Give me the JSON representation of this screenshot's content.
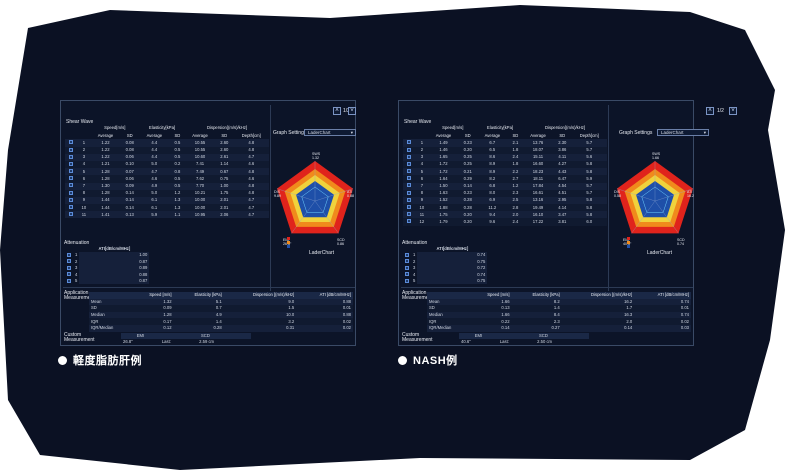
{
  "colors": {
    "background_shape": "#0b1123",
    "panel_bg": "#0c1428",
    "radar_red": "#e0231c",
    "radar_orange": "#f08a1c",
    "radar_yellow": "#f0d23c",
    "radar_blue": "#1e4fa8"
  },
  "left": {
    "caption": "軽度脂肪肝例",
    "shear_wave_title": "Shear Wave",
    "group_headers": [
      "Speed[m/s]",
      "Elasticity[kPa]",
      "Dispersion[(m/s)/kHz]"
    ],
    "sub_headers": [
      "Average",
      "SD",
      "Average",
      "SD",
      "Average",
      "SD",
      "Depth[cm]"
    ],
    "rows": [
      [
        "1",
        "1.22",
        "0.08",
        "4.4",
        "0.5",
        "10.55",
        "2.60",
        "4.8"
      ],
      [
        "2",
        "1.22",
        "0.08",
        "4.4",
        "0.5",
        "10.55",
        "2.60",
        "4.8"
      ],
      [
        "3",
        "1.22",
        "0.06",
        "4.4",
        "0.5",
        "10.60",
        "2.61",
        "4.7"
      ],
      [
        "4",
        "1.21",
        "0.10",
        "5.0",
        "0.2",
        "7.41",
        "1.14",
        "4.6"
      ],
      [
        "5",
        "1.28",
        "0.07",
        "4.7",
        "0.8",
        "7.49",
        "0.67",
        "4.8"
      ],
      [
        "6",
        "1.28",
        "0.06",
        "4.6",
        "0.5",
        "7.62",
        "0.75",
        "4.6"
      ],
      [
        "7",
        "1.30",
        "0.09",
        "4.9",
        "0.5",
        "7.70",
        "1.00",
        "4.8"
      ],
      [
        "8",
        "1.28",
        "0.14",
        "5.0",
        "1.2",
        "10.21",
        "1.75",
        "4.8"
      ],
      [
        "9",
        "1.44",
        "0.14",
        "6.1",
        "1.3",
        "10.00",
        "2.01",
        "4.7"
      ],
      [
        "10",
        "1.44",
        "0.14",
        "6.1",
        "1.3",
        "10.00",
        "2.01",
        "4.7"
      ],
      [
        "11",
        "1.41",
        "0.13",
        "5.9",
        "1.1",
        "10.95",
        "2.06",
        "4.7"
      ]
    ],
    "attenuation_title": "Attenuation",
    "att_header": "ATI[dB/cm/MHz]",
    "att_rows": [
      [
        "1",
        "1.00"
      ],
      [
        "2",
        "0.87"
      ],
      [
        "3",
        "0.89"
      ],
      [
        "4",
        "0.88"
      ],
      [
        "5",
        "0.87"
      ]
    ],
    "app_title": "Application Measurement",
    "meas_headers": [
      "Speed [m/s]",
      "Elasticity [kPa]",
      "Dispersion [(m/s)/kHz]",
      "ATI [dB/cm/MHz]"
    ],
    "meas_rows": [
      [
        "Mean",
        "1.32",
        "5.1",
        "9.0",
        "0.88"
      ],
      [
        "SD",
        "0.09",
        "0.7",
        "1.5",
        "0.01"
      ],
      [
        "Median",
        "1.28",
        "4.9",
        "10.0",
        "0.88"
      ],
      [
        "IQR",
        "0.17",
        "1.4",
        "3.2",
        "0.02"
      ],
      [
        "IQR/Median",
        "0.12",
        "0.28",
        "0.31",
        "0.02"
      ]
    ],
    "custom_title": "Custom Measurement",
    "custom_headers": [
      "EMI",
      "SCD"
    ],
    "custom_values": [
      "26.8\"",
      "Last:",
      "2.59 cm"
    ],
    "graph_settings_label": "Graph Settings",
    "graph_select": "LaderChart",
    "pager": "1/2",
    "radar_labels": {
      "top": "SWS",
      "top_val": "1.32",
      "left": "DIS",
      "left_val": "9.89",
      "right": "ATI",
      "right_val": "0.88",
      "bl": "EMI",
      "bl_val": "26.8\"",
      "br": "SCD",
      "br_val": "0.86"
    },
    "chart_title": "LaderChart"
  },
  "right": {
    "caption": "NASH例",
    "shear_wave_title": "Shear Wave",
    "group_headers": [
      "Speed[m/s]",
      "Elasticity[kPa]",
      "Dispersion[(m/s)/kHz]"
    ],
    "sub_headers": [
      "Average",
      "SD",
      "Average",
      "SD",
      "Average",
      "SD",
      "Depth[cm]"
    ],
    "rows": [
      [
        "1",
        "1.49",
        "0.23",
        "6.7",
        "2.1",
        "13.76",
        "2.30",
        "5.7"
      ],
      [
        "2",
        "1.46",
        "0.20",
        "6.5",
        "1.8",
        "18.07",
        "3.86",
        "5.7"
      ],
      [
        "3",
        "1.65",
        "0.25",
        "8.6",
        "2.4",
        "15.11",
        "4.11",
        "5.6"
      ],
      [
        "4",
        "1.72",
        "0.25",
        "8.9",
        "1.8",
        "16.60",
        "4.27",
        "5.8"
      ],
      [
        "5",
        "1.72",
        "0.21",
        "8.9",
        "2.2",
        "18.23",
        "4.43",
        "5.8"
      ],
      [
        "6",
        "1.64",
        "0.29",
        "8.2",
        "2.7",
        "18.11",
        "6.47",
        "5.9"
      ],
      [
        "7",
        "1.50",
        "0.14",
        "6.8",
        "1.2",
        "17.84",
        "4.54",
        "5.7"
      ],
      [
        "8",
        "1.63",
        "0.23",
        "8.0",
        "2.3",
        "16.61",
        "4.51",
        "5.7"
      ],
      [
        "9",
        "1.52",
        "0.28",
        "6.9",
        "2.5",
        "13.16",
        "2.95",
        "5.8"
      ],
      [
        "10",
        "1.88",
        "0.28",
        "11.2",
        "2.8",
        "19.49",
        "4.14",
        "5.8"
      ],
      [
        "11",
        "1.75",
        "0.20",
        "9.4",
        "2.0",
        "16.10",
        "3.47",
        "5.8"
      ],
      [
        "12",
        "1.79",
        "0.20",
        "9.6",
        "2.4",
        "17.22",
        "3.81",
        "6.0"
      ]
    ],
    "attenuation_title": "Attenuation",
    "att_header": "ATI[dB/cm/MHz]",
    "att_rows": [
      [
        "1",
        "0.74"
      ],
      [
        "2",
        "0.75"
      ],
      [
        "3",
        "0.72"
      ],
      [
        "4",
        "0.74"
      ],
      [
        "5",
        "0.75"
      ]
    ],
    "app_title": "Application Measurement",
    "meas_headers": [
      "Speed [m/s]",
      "Elasticity [kPa]",
      "Dispersion [(m/s)/kHz]",
      "ATI [dB/cm/MHz]"
    ],
    "meas_rows": [
      [
        "Mean",
        "1.66",
        "8.2",
        "16.2",
        "0.74"
      ],
      [
        "SD",
        "0.13",
        "1.4",
        "1.7",
        "0.01"
      ],
      [
        "Median",
        "1.66",
        "8.4",
        "16.3",
        "0.74"
      ],
      [
        "IQR",
        "0.22",
        "2.3",
        "2.0",
        "0.02"
      ],
      [
        "IQR/Median",
        "0.14",
        "0.27",
        "0.14",
        "0.03"
      ]
    ],
    "custom_title": "Custom Measurement",
    "custom_headers": [
      "EMI",
      "SCD"
    ],
    "custom_values": [
      "40.6\"",
      "Last:",
      "2.50 cm"
    ],
    "graph_settings_label": "Graph Settings",
    "graph_select": "LaderChart",
    "pager": "1/2",
    "radar_labels": {
      "top": "SWS",
      "top_val": "1.66",
      "left": "DIS",
      "left_val": "0.58",
      "right": "ATI",
      "right_val": "16.2",
      "bl": "EMI",
      "bl_val": "40.6\"",
      "br": "SCD",
      "br_val": "0.74"
    },
    "chart_title": "LaderChart"
  }
}
